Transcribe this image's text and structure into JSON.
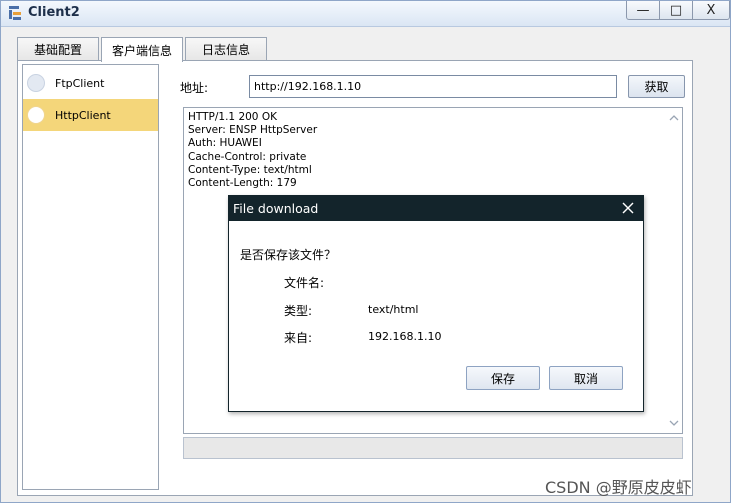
{
  "window": {
    "title": "Client2",
    "min_symbol": "—",
    "max_symbol": "□",
    "close_symbol": "X"
  },
  "tabs": [
    {
      "label": "基础配置"
    },
    {
      "label": "客户端信息"
    },
    {
      "label": "日志信息"
    }
  ],
  "sidebar": {
    "items": [
      {
        "label": "FtpClient",
        "selected": false
      },
      {
        "label": "HttpClient",
        "selected": true
      }
    ]
  },
  "address": {
    "label": "地址:",
    "value": "http://192.168.1.10",
    "fetch_label": "获取"
  },
  "response": {
    "lines": [
      "HTTP/1.1 200 OK",
      "Server: ENSP HttpServer",
      "Auth: HUAWEI",
      "Cache-Control: private",
      "Content-Type: text/html",
      "Content-Length: 179"
    ]
  },
  "dialog": {
    "title": "File download",
    "question": "是否保存该文件？",
    "filename_label": "文件名:",
    "filename_value": "",
    "type_label": "类型:",
    "type_value": "text/html",
    "from_label": "来自:",
    "from_value": "192.168.1.10",
    "save_label": "保存",
    "cancel_label": "取消"
  },
  "watermark": "CSDN @野原皮皮虾",
  "colors": {
    "selected_item": "#f4d67a",
    "dialog_titlebar": "#13242b"
  },
  "icons": {
    "app": "client-app-icon",
    "close": "close-icon",
    "scroll_up": "chevron-up-icon",
    "scroll_down": "chevron-down-icon"
  }
}
